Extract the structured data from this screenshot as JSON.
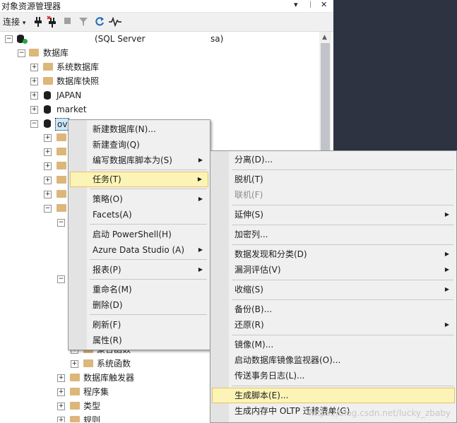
{
  "panel": {
    "title": "对象资源管理器",
    "title_buttons": [
      "▾",
      "ᛁ",
      "✕"
    ]
  },
  "toolbar": {
    "connect_label": "连接",
    "connect_arrow": "▾"
  },
  "tree": {
    "server": {
      "label": "(SQL Server",
      "user": "sa)"
    },
    "databases": "数据库",
    "items": [
      "系统数据库",
      "数据库快照",
      "JAPAN",
      "market",
      "ov"
    ],
    "lower": [
      "聚合函数",
      "系统函数",
      "数据库触发器",
      "程序集",
      "类型",
      "规则"
    ]
  },
  "context_menu": {
    "items": [
      {
        "label": "新建数据库(N)...",
        "submenu": false
      },
      {
        "label": "新建查询(Q)",
        "submenu": false
      },
      {
        "label": "编写数据库脚本为(S)",
        "submenu": true
      },
      {
        "label": "任务(T)",
        "submenu": true,
        "highlighted": true
      },
      {
        "label": "策略(O)",
        "submenu": true
      },
      {
        "label": "Facets(A)",
        "submenu": false
      },
      {
        "label": "启动 PowerShell(H)",
        "submenu": false
      },
      {
        "label": "Azure Data Studio (A)",
        "submenu": true
      },
      {
        "label": "报表(P)",
        "submenu": true
      },
      {
        "label": "重命名(M)",
        "submenu": false
      },
      {
        "label": "删除(D)",
        "submenu": false
      },
      {
        "label": "刷新(F)",
        "submenu": false
      },
      {
        "label": "属性(R)",
        "submenu": false
      }
    ]
  },
  "task_menu": {
    "items": [
      {
        "label": "分离(D)...",
        "submenu": false
      },
      {
        "label": "脱机(T)",
        "submenu": false
      },
      {
        "label": "联机(F)",
        "submenu": false,
        "disabled": true
      },
      {
        "label": "延伸(S)",
        "submenu": true
      },
      {
        "label": "加密列...",
        "submenu": false
      },
      {
        "label": "数据发现和分类(D)",
        "submenu": true
      },
      {
        "label": "漏洞评估(V)",
        "submenu": true
      },
      {
        "label": "收缩(S)",
        "submenu": true
      },
      {
        "label": "备份(B)...",
        "submenu": false
      },
      {
        "label": "还原(R)",
        "submenu": true
      },
      {
        "label": "镜像(M)...",
        "submenu": false
      },
      {
        "label": "启动数据库镜像监视器(O)...",
        "submenu": false
      },
      {
        "label": "传送事务日志(L)...",
        "submenu": false
      },
      {
        "label": "生成脚本(E)...",
        "submenu": false,
        "highlighted": true
      },
      {
        "label": "生成内存中 OLTP 迁移清单(G)",
        "submenu": false
      }
    ]
  },
  "arrow_glyph": "▶",
  "watermark": "https://blog.csdn.net/lucky_zbaby",
  "colors": {
    "highlight_bg": "#fcf4b6",
    "highlight_border": "#e5c365",
    "selected_node": "#cce8ff"
  }
}
